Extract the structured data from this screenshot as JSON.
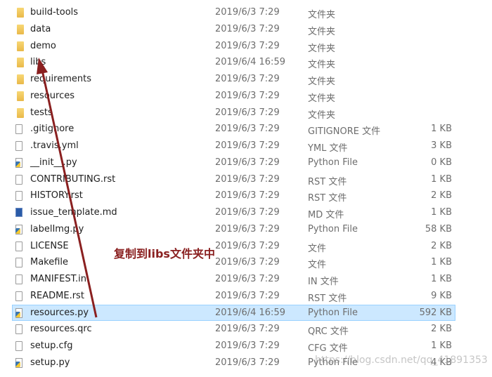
{
  "files": [
    {
      "name": "build-tools",
      "date": "2019/6/3 7:29",
      "type": "文件夹",
      "size": "",
      "icon": "folder-icon"
    },
    {
      "name": "data",
      "date": "2019/6/3 7:29",
      "type": "文件夹",
      "size": "",
      "icon": "folder-icon"
    },
    {
      "name": "demo",
      "date": "2019/6/3 7:29",
      "type": "文件夹",
      "size": "",
      "icon": "folder-icon"
    },
    {
      "name": "libs",
      "date": "2019/6/4 16:59",
      "type": "文件夹",
      "size": "",
      "icon": "folder-icon"
    },
    {
      "name": "requirements",
      "date": "2019/6/3 7:29",
      "type": "文件夹",
      "size": "",
      "icon": "folder-icon"
    },
    {
      "name": "resources",
      "date": "2019/6/3 7:29",
      "type": "文件夹",
      "size": "",
      "icon": "folder-icon"
    },
    {
      "name": "tests",
      "date": "2019/6/3 7:29",
      "type": "文件夹",
      "size": "",
      "icon": "folder-icon"
    },
    {
      "name": ".gitignore",
      "date": "2019/6/3 7:29",
      "type": "GITIGNORE 文件",
      "size": "1 KB",
      "icon": "file-icon"
    },
    {
      "name": ".travis.yml",
      "date": "2019/6/3 7:29",
      "type": "YML 文件",
      "size": "3 KB",
      "icon": "file-icon"
    },
    {
      "name": "__init__.py",
      "date": "2019/6/3 7:29",
      "type": "Python File",
      "size": "0 KB",
      "icon": "python-file-icon"
    },
    {
      "name": "CONTRIBUTING.rst",
      "date": "2019/6/3 7:29",
      "type": "RST 文件",
      "size": "1 KB",
      "icon": "file-icon"
    },
    {
      "name": "HISTORY.rst",
      "date": "2019/6/3 7:29",
      "type": "RST 文件",
      "size": "2 KB",
      "icon": "file-icon"
    },
    {
      "name": "issue_template.md",
      "date": "2019/6/3 7:29",
      "type": "MD 文件",
      "size": "1 KB",
      "icon": "markdown-file-icon"
    },
    {
      "name": "labelImg.py",
      "date": "2019/6/3 7:29",
      "type": "Python File",
      "size": "58 KB",
      "icon": "python-file-icon"
    },
    {
      "name": "LICENSE",
      "date": "2019/6/3 7:29",
      "type": "文件",
      "size": "2 KB",
      "icon": "file-icon"
    },
    {
      "name": "Makefile",
      "date": "2019/6/3 7:29",
      "type": "文件",
      "size": "1 KB",
      "icon": "file-icon"
    },
    {
      "name": "MANIFEST.in",
      "date": "2019/6/3 7:29",
      "type": "IN 文件",
      "size": "1 KB",
      "icon": "file-icon"
    },
    {
      "name": "README.rst",
      "date": "2019/6/3 7:29",
      "type": "RST 文件",
      "size": "9 KB",
      "icon": "file-icon"
    },
    {
      "name": "resources.py",
      "date": "2019/6/4 16:59",
      "type": "Python File",
      "size": "592 KB",
      "icon": "python-file-icon",
      "selected": true
    },
    {
      "name": "resources.qrc",
      "date": "2019/6/3 7:29",
      "type": "QRC 文件",
      "size": "2 KB",
      "icon": "file-icon"
    },
    {
      "name": "setup.cfg",
      "date": "2019/6/3 7:29",
      "type": "CFG 文件",
      "size": "1 KB",
      "icon": "file-icon"
    },
    {
      "name": "setup.py",
      "date": "2019/6/3 7:29",
      "type": "Python File",
      "size": "4 KB",
      "icon": "python-file-icon"
    }
  ],
  "annotation": {
    "text": "复制到libs文件夹中",
    "color": "#8a2020"
  },
  "watermark": "https://blog.csdn.net/qq_41891353",
  "colors": {
    "selection_bg": "#cce8ff",
    "selection_border": "#99d1ff",
    "arrow": "#8a2020"
  }
}
